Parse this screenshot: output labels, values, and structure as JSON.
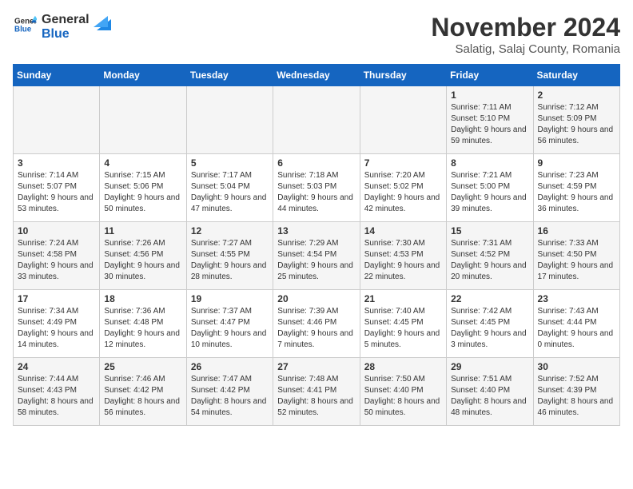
{
  "header": {
    "logo_general": "General",
    "logo_blue": "Blue",
    "month_title": "November 2024",
    "location": "Salatig, Salaj County, Romania"
  },
  "days_of_week": [
    "Sunday",
    "Monday",
    "Tuesday",
    "Wednesday",
    "Thursday",
    "Friday",
    "Saturday"
  ],
  "weeks": [
    [
      {
        "day": "",
        "info": ""
      },
      {
        "day": "",
        "info": ""
      },
      {
        "day": "",
        "info": ""
      },
      {
        "day": "",
        "info": ""
      },
      {
        "day": "",
        "info": ""
      },
      {
        "day": "1",
        "info": "Sunrise: 7:11 AM\nSunset: 5:10 PM\nDaylight: 9 hours and 59 minutes."
      },
      {
        "day": "2",
        "info": "Sunrise: 7:12 AM\nSunset: 5:09 PM\nDaylight: 9 hours and 56 minutes."
      }
    ],
    [
      {
        "day": "3",
        "info": "Sunrise: 7:14 AM\nSunset: 5:07 PM\nDaylight: 9 hours and 53 minutes."
      },
      {
        "day": "4",
        "info": "Sunrise: 7:15 AM\nSunset: 5:06 PM\nDaylight: 9 hours and 50 minutes."
      },
      {
        "day": "5",
        "info": "Sunrise: 7:17 AM\nSunset: 5:04 PM\nDaylight: 9 hours and 47 minutes."
      },
      {
        "day": "6",
        "info": "Sunrise: 7:18 AM\nSunset: 5:03 PM\nDaylight: 9 hours and 44 minutes."
      },
      {
        "day": "7",
        "info": "Sunrise: 7:20 AM\nSunset: 5:02 PM\nDaylight: 9 hours and 42 minutes."
      },
      {
        "day": "8",
        "info": "Sunrise: 7:21 AM\nSunset: 5:00 PM\nDaylight: 9 hours and 39 minutes."
      },
      {
        "day": "9",
        "info": "Sunrise: 7:23 AM\nSunset: 4:59 PM\nDaylight: 9 hours and 36 minutes."
      }
    ],
    [
      {
        "day": "10",
        "info": "Sunrise: 7:24 AM\nSunset: 4:58 PM\nDaylight: 9 hours and 33 minutes."
      },
      {
        "day": "11",
        "info": "Sunrise: 7:26 AM\nSunset: 4:56 PM\nDaylight: 9 hours and 30 minutes."
      },
      {
        "day": "12",
        "info": "Sunrise: 7:27 AM\nSunset: 4:55 PM\nDaylight: 9 hours and 28 minutes."
      },
      {
        "day": "13",
        "info": "Sunrise: 7:29 AM\nSunset: 4:54 PM\nDaylight: 9 hours and 25 minutes."
      },
      {
        "day": "14",
        "info": "Sunrise: 7:30 AM\nSunset: 4:53 PM\nDaylight: 9 hours and 22 minutes."
      },
      {
        "day": "15",
        "info": "Sunrise: 7:31 AM\nSunset: 4:52 PM\nDaylight: 9 hours and 20 minutes."
      },
      {
        "day": "16",
        "info": "Sunrise: 7:33 AM\nSunset: 4:50 PM\nDaylight: 9 hours and 17 minutes."
      }
    ],
    [
      {
        "day": "17",
        "info": "Sunrise: 7:34 AM\nSunset: 4:49 PM\nDaylight: 9 hours and 14 minutes."
      },
      {
        "day": "18",
        "info": "Sunrise: 7:36 AM\nSunset: 4:48 PM\nDaylight: 9 hours and 12 minutes."
      },
      {
        "day": "19",
        "info": "Sunrise: 7:37 AM\nSunset: 4:47 PM\nDaylight: 9 hours and 10 minutes."
      },
      {
        "day": "20",
        "info": "Sunrise: 7:39 AM\nSunset: 4:46 PM\nDaylight: 9 hours and 7 minutes."
      },
      {
        "day": "21",
        "info": "Sunrise: 7:40 AM\nSunset: 4:45 PM\nDaylight: 9 hours and 5 minutes."
      },
      {
        "day": "22",
        "info": "Sunrise: 7:42 AM\nSunset: 4:45 PM\nDaylight: 9 hours and 3 minutes."
      },
      {
        "day": "23",
        "info": "Sunrise: 7:43 AM\nSunset: 4:44 PM\nDaylight: 9 hours and 0 minutes."
      }
    ],
    [
      {
        "day": "24",
        "info": "Sunrise: 7:44 AM\nSunset: 4:43 PM\nDaylight: 8 hours and 58 minutes."
      },
      {
        "day": "25",
        "info": "Sunrise: 7:46 AM\nSunset: 4:42 PM\nDaylight: 8 hours and 56 minutes."
      },
      {
        "day": "26",
        "info": "Sunrise: 7:47 AM\nSunset: 4:42 PM\nDaylight: 8 hours and 54 minutes."
      },
      {
        "day": "27",
        "info": "Sunrise: 7:48 AM\nSunset: 4:41 PM\nDaylight: 8 hours and 52 minutes."
      },
      {
        "day": "28",
        "info": "Sunrise: 7:50 AM\nSunset: 4:40 PM\nDaylight: 8 hours and 50 minutes."
      },
      {
        "day": "29",
        "info": "Sunrise: 7:51 AM\nSunset: 4:40 PM\nDaylight: 8 hours and 48 minutes."
      },
      {
        "day": "30",
        "info": "Sunrise: 7:52 AM\nSunset: 4:39 PM\nDaylight: 8 hours and 46 minutes."
      }
    ]
  ]
}
